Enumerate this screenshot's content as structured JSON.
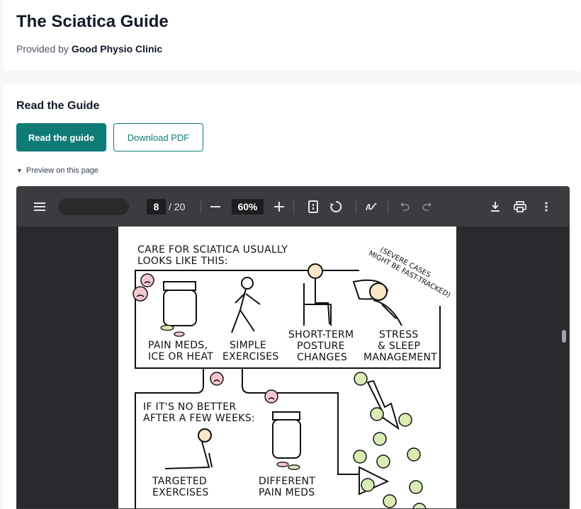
{
  "header": {
    "title": "The Sciatica Guide",
    "provided_prefix": "Provided by",
    "provider": "Good Physio Clinic"
  },
  "guide": {
    "section_title": "Read the Guide",
    "read_button": "Read the guide",
    "download_button": "Download PDF",
    "preview_label": "Preview on this page"
  },
  "viewer": {
    "current_page": "8",
    "total_pages": "/ 20",
    "zoom": "60%",
    "icons": [
      "menu-icon",
      "zoom-out-icon",
      "zoom-in-icon",
      "fit-page-icon",
      "rotate-icon",
      "draw-icon",
      "undo-icon",
      "redo-icon",
      "download-icon",
      "print-icon",
      "more-icon"
    ]
  },
  "comic": {
    "heading_line1": "CARE FOR SCIATICA USUALLY",
    "heading_line2": "LOOKS LIKE THIS:",
    "note_line1": "(SEVERE CASES",
    "note_line2": "MIGHT BE FAST-TRACKED)",
    "items": [
      {
        "line1": "PAIN MEDS,",
        "line2": "ICE OR HEAT"
      },
      {
        "line1": "SIMPLE",
        "line2": "EXERCISES"
      },
      {
        "line1": "SHORT-TERM",
        "line2": "POSTURE",
        "line3": "CHANGES"
      },
      {
        "line1": "STRESS",
        "line2": "& SLEEP",
        "line3": "MANAGEMENT"
      }
    ],
    "second_heading_line1": "IF IT'S NO BETTER",
    "second_heading_line2": "AFTER A FEW WEEKS:",
    "second_items": [
      {
        "line1": "TARGETED",
        "line2": "EXERCISES"
      },
      {
        "line1": "DIFFERENT",
        "line2": "PAIN MEDS"
      }
    ]
  }
}
